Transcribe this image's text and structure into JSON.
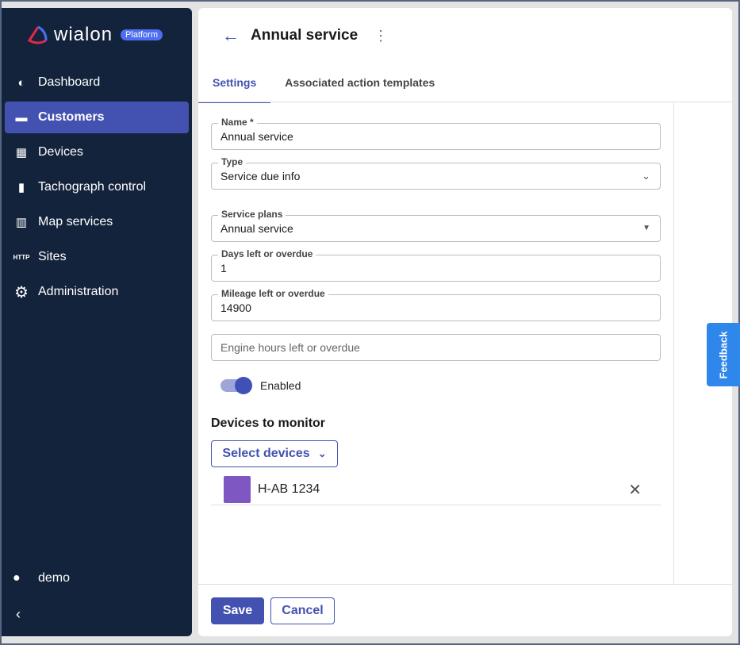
{
  "logo": {
    "word": "wialon",
    "badge": "Platform"
  },
  "sidebar": {
    "items": [
      {
        "label": "Dashboard",
        "icon": "◐"
      },
      {
        "label": "Customers",
        "icon": "💼"
      },
      {
        "label": "Devices",
        "icon": "▦"
      },
      {
        "label": "Tachograph control",
        "icon": "▼"
      },
      {
        "label": "Map services",
        "icon": "▥"
      },
      {
        "label": "Sites",
        "icon": "HTTP"
      },
      {
        "label": "Administration",
        "icon": "⚙"
      }
    ],
    "user": "demo"
  },
  "header": {
    "title": "Annual service"
  },
  "tabs": [
    "Settings",
    "Associated action templates"
  ],
  "form": {
    "name": {
      "label": "Name *",
      "value": "Annual service"
    },
    "type": {
      "label": "Type",
      "value": "Service due info"
    },
    "plans": {
      "label": "Service plans",
      "value": "Annual service"
    },
    "days": {
      "label": "Days left or overdue",
      "value": "1"
    },
    "mileage": {
      "label": "Mileage left or overdue",
      "value": "14900"
    },
    "engine": {
      "placeholder": "Engine hours left or overdue"
    },
    "enabled": {
      "label": "Enabled",
      "on": true
    }
  },
  "devices": {
    "title": "Devices to monitor",
    "select_label": "Select devices",
    "items": [
      {
        "name": "H-AB 1234",
        "color": "#7e57c2"
      }
    ]
  },
  "footer": {
    "save": "Save",
    "cancel": "Cancel"
  },
  "feedback": "Feedback"
}
